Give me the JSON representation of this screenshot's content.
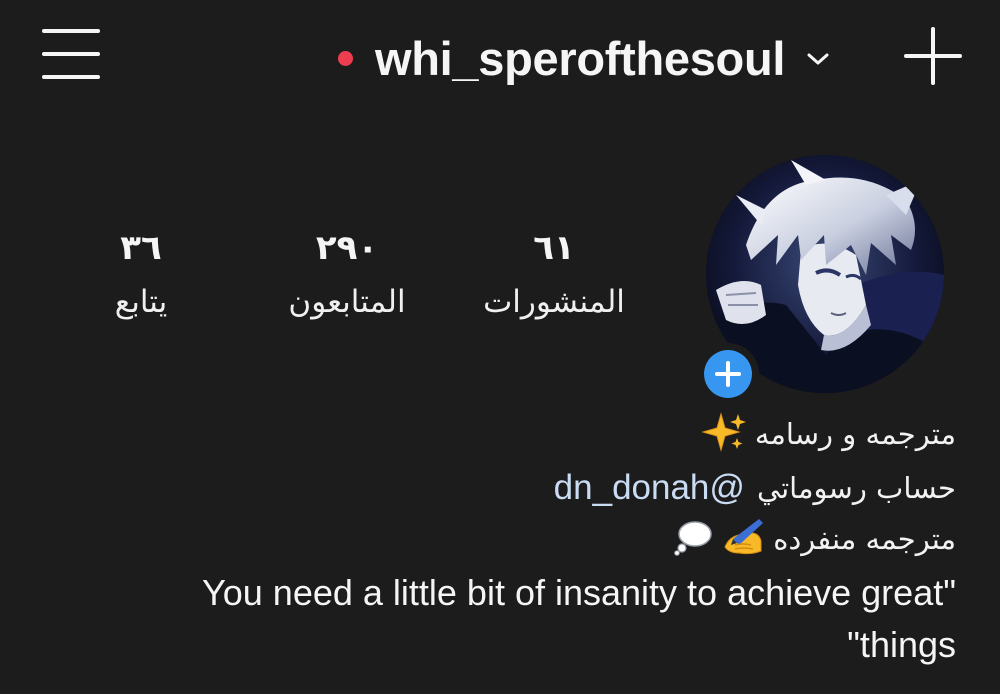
{
  "header": {
    "username": "whi_sperofthesoul",
    "live_dot_color": "#ef3d50",
    "menu_icon": "hamburger-menu-icon",
    "switch_icon": "chevron-down-icon",
    "create_icon": "plus-icon"
  },
  "profile": {
    "avatar_icon": "anime-portrait-avatar",
    "add_story_icon": "plus-circle-icon",
    "add_story_color": "#3797f0"
  },
  "stats": {
    "posts": {
      "value": "٦١",
      "label": "المنشورات"
    },
    "followers": {
      "value": "٢٩٠",
      "label": "المتابعون"
    },
    "following": {
      "value": "٣٦",
      "label": "يتابع"
    }
  },
  "bio": {
    "line1": {
      "text": "مترجمه و رسامه",
      "emoji": "sparkles-emoji"
    },
    "line2": {
      "text": "حساب رسوماتي",
      "mention": "dn_donah@"
    },
    "line3": {
      "text": "مترجمه منفرده",
      "emojis": [
        "writing-hand-emoji",
        "thought-balloon-emoji"
      ]
    },
    "quote": "You need a little bit of insanity to achieve great\" \"things"
  },
  "colors": {
    "background": "#1c1c1c",
    "text": "#f5f5f5",
    "mention": "#c9dcf3"
  }
}
